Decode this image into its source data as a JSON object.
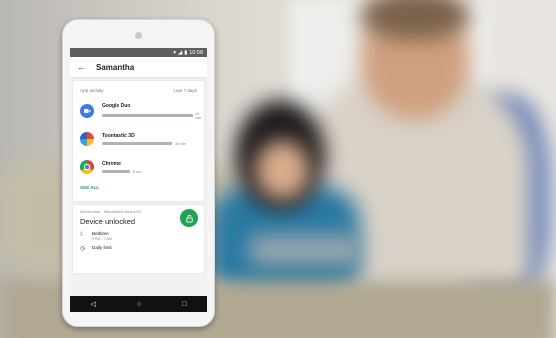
{
  "status_bar": {
    "time": "10:58"
  },
  "app_bar": {
    "back_glyph": "←",
    "title": "Samantha"
  },
  "app_activity": {
    "header_label": "App activity",
    "period": "Last 7 days",
    "apps": [
      {
        "name": "Google Duo",
        "duration": "41 min",
        "bar_fraction": 0.95,
        "icon": "google-duo-icon",
        "color": "#3d7be6"
      },
      {
        "name": "Toontastic 3D",
        "duration": "30 min",
        "bar_fraction": 0.7,
        "icon": "toontastic-icon",
        "color": "#2d63c6"
      },
      {
        "name": "Chrome",
        "duration": "5 min",
        "bar_fraction": 0.28,
        "icon": "chrome-icon",
        "color": "#e44134"
      }
    ],
    "see_all": "SEE ALL"
  },
  "device_card": {
    "screen_time_label": "Screen time · Samantha's Nexus 5X",
    "status": "Device unlocked",
    "lock_button_color": "#21a355",
    "options": [
      {
        "label": "Bedtime",
        "sub": "9 PM - 7 AM",
        "icon": "moon-icon"
      },
      {
        "label": "Daily limit",
        "sub": "",
        "icon": "timer-icon"
      }
    ]
  },
  "nav": {
    "back": "◁",
    "home": "○",
    "recents": "□"
  }
}
